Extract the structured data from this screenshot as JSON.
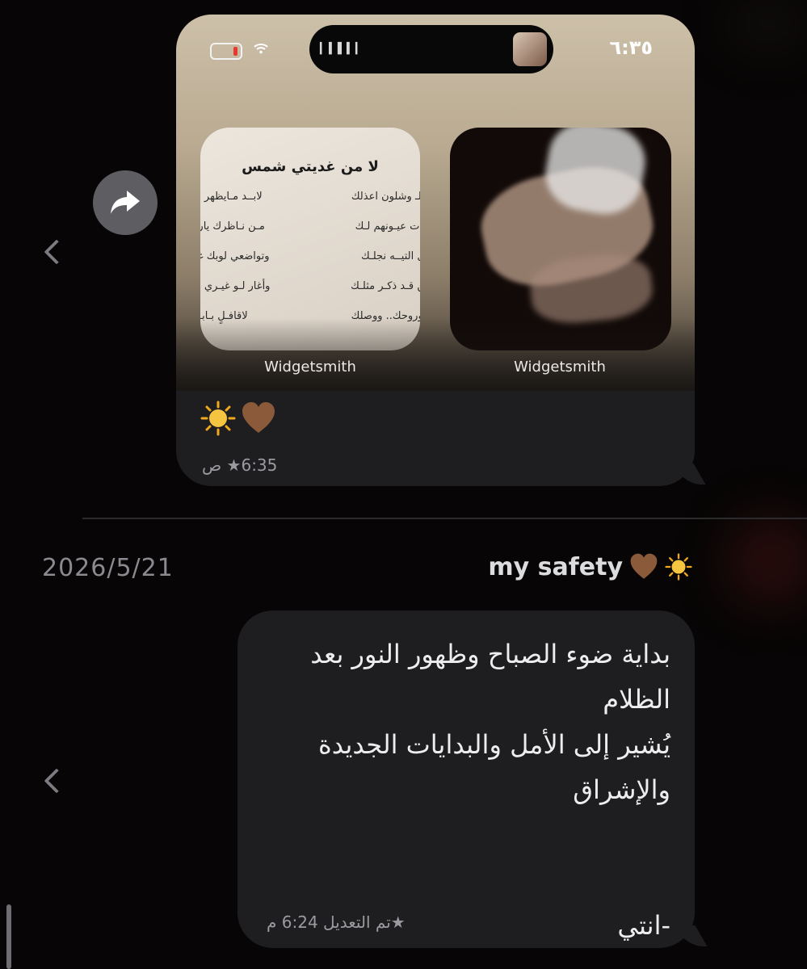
{
  "status_bar": {
    "time": "٦:٣٥"
  },
  "widgets": {
    "left_title": "لا من غديتي شمس",
    "left_lines": [
      {
        "a": "..لـ وشلون اعذلك",
        "b": "لابــد مـايظهر مـ"
      },
      {
        "a": "ـدت عيـونهم لـك",
        "b": "مـن نـاظرك ياربـ"
      },
      {
        "a": "ـل التيــه نجلـك",
        "b": "وتواضعي لوبك غد"
      },
      {
        "a": "ـن قـد ذكـر مثلـك",
        "b": "وأغار لـو غيـري مـ"
      },
      {
        "a": "ووروحك.. ووصلك",
        "b": "لاقافـلٍ بـابـ.. "
      }
    ],
    "left_label": "Widgetsmith",
    "right_label": "Widgetsmith"
  },
  "message1": {
    "meta": "6:35★ ص"
  },
  "date_header": "2026/5/21",
  "sender": {
    "name": "my safety"
  },
  "message2": {
    "text": "بداية ضوء الصباح وظهور النور بعد\nالظلام\nيُشير إلى الأمل والبدايات الجديدة\nوالإشراق\n\n\n-انتي",
    "meta": "★تم التعديل 6:24 م"
  },
  "colors": {
    "background": "#070505",
    "bubble": "#1e1e21",
    "heart": "#8a5a3a",
    "sun": "#f5c542"
  },
  "icons": [
    "chevron-left-icon",
    "forward-icon",
    "sun-emoji",
    "brown-heart-emoji",
    "star-icon"
  ]
}
